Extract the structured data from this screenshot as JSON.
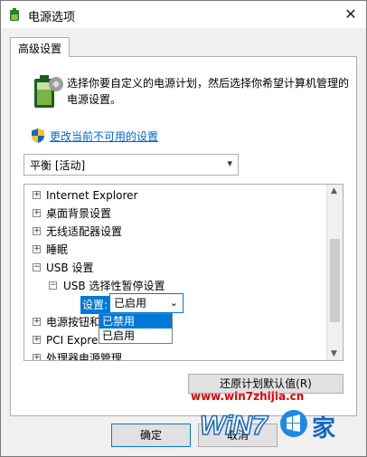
{
  "window": {
    "title": "电源选项",
    "close_glyph": "✕"
  },
  "tab": {
    "label": "高级设置"
  },
  "description": "选择你要自定义的电源计划，然后选择你希望计算机管理的电源设置。",
  "change_link": "更改当前不可用的设置",
  "plan_select": {
    "value": "平衡 [活动]"
  },
  "tree": {
    "items": [
      {
        "label": "Internet Explorer",
        "expander": "+"
      },
      {
        "label": "桌面背景设置",
        "expander": "+"
      },
      {
        "label": "无线适配器设置",
        "expander": "+"
      },
      {
        "label": "睡眠",
        "expander": "+"
      },
      {
        "label": "USB 设置",
        "expander": "−"
      },
      {
        "label": "USB 选择性暂停设置",
        "expander": "−"
      },
      {
        "label": "电源按钮和盖",
        "expander": "+"
      },
      {
        "label": "PCI Express",
        "expander": "+"
      },
      {
        "label": "处理器电源管理",
        "expander": "+"
      }
    ],
    "setting_label": "设置:",
    "setting_value": "已启用"
  },
  "dropdown": {
    "options": [
      "已禁用",
      "已启用"
    ],
    "selected_index": 0
  },
  "buttons": {
    "restore": "还原计划默认值(R)",
    "ok": "确定",
    "cancel": "取消"
  },
  "watermark": {
    "url": "www.win7zhijia.cn",
    "logo_text": "WiN7",
    "logo_char": "家"
  },
  "colors": {
    "accent": "#0078d7",
    "link": "#0066cc",
    "watermark_red": "#e00000"
  },
  "icons": {
    "app": "power-options-icon",
    "battery": "battery-icon",
    "shield": "uac-shield-icon"
  }
}
